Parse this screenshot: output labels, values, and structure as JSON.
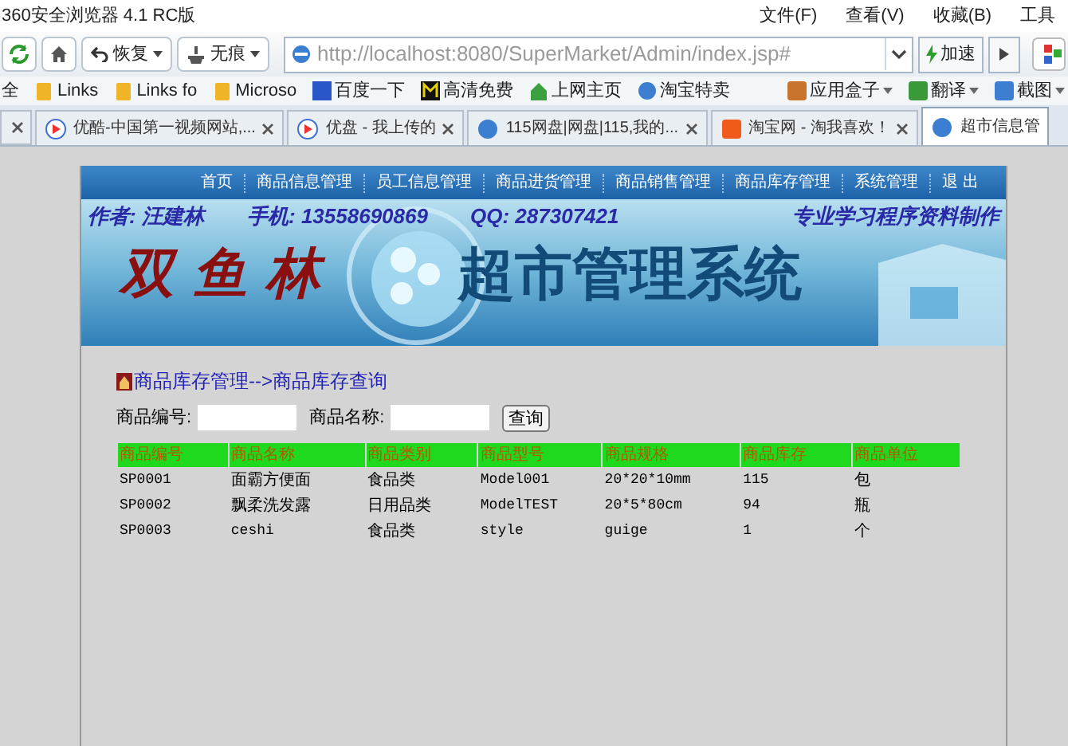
{
  "browser": {
    "title": "360安全浏览器 4.1 RC版",
    "menu": [
      "文件(F)",
      "查看(V)",
      "收藏(B)",
      "工具"
    ],
    "toolbar": {
      "restore": "恢复",
      "incognito": "无痕",
      "address": "http://localhost:8080/SuperMarket/Admin/index.jsp#",
      "speed": "加速"
    },
    "bookmarks": [
      {
        "label": "全",
        "kind": "text"
      },
      {
        "label": "Links",
        "kind": "folder"
      },
      {
        "label": "Links fo",
        "kind": "folder"
      },
      {
        "label": "Microso",
        "kind": "folder"
      },
      {
        "label": "百度一下",
        "kind": "site"
      },
      {
        "label": "高清免费",
        "kind": "site"
      },
      {
        "label": "上网主页",
        "kind": "site"
      },
      {
        "label": "淘宝特卖",
        "kind": "site"
      }
    ],
    "tools": [
      "应用盒子",
      "翻译",
      "截图"
    ],
    "tabs": [
      {
        "label": "优酷-中国第一视频网站,...",
        "selected": false
      },
      {
        "label": "优盘 - 我上传的",
        "selected": false
      },
      {
        "label": "115网盘|网盘|115,我的...",
        "selected": false
      },
      {
        "label": "淘宝网 - 淘我喜欢！",
        "selected": false
      },
      {
        "label": "超市信息管",
        "selected": true
      }
    ]
  },
  "nav": [
    "首页",
    "商品信息管理",
    "员工信息管理",
    "商品进货管理",
    "商品销售管理",
    "商品库存管理",
    "系统管理",
    "退 出"
  ],
  "banner": {
    "author": "作者: 汪建林",
    "phone": "手机: 13558690869",
    "qq": "QQ: 287307421",
    "slogan": "专业学习程序资料制作",
    "brand": "双 鱼 林",
    "system": "超市管理系统"
  },
  "breadcrumb": "商品库存管理-->商品库存查询",
  "search": {
    "fields": [
      {
        "label": "商品编号:"
      },
      {
        "label": "商品名称:"
      }
    ],
    "button": "查询"
  },
  "table": {
    "columns": [
      "商品编号",
      "商品名称",
      "商品类别",
      "商品型号",
      "商品规格",
      "商品库存",
      "商品单位"
    ],
    "rows": [
      [
        "SP0001",
        "面霸方便面",
        "食品类",
        "Model001",
        "20*20*10mm",
        "115",
        "包"
      ],
      [
        "SP0002",
        "飘柔洗发露",
        "日用品类",
        "ModelTEST",
        "20*5*80cm",
        "94",
        "瓶"
      ],
      [
        "SP0003",
        "ceshi",
        "食品类",
        "style",
        "guige",
        "1",
        "个"
      ]
    ]
  }
}
